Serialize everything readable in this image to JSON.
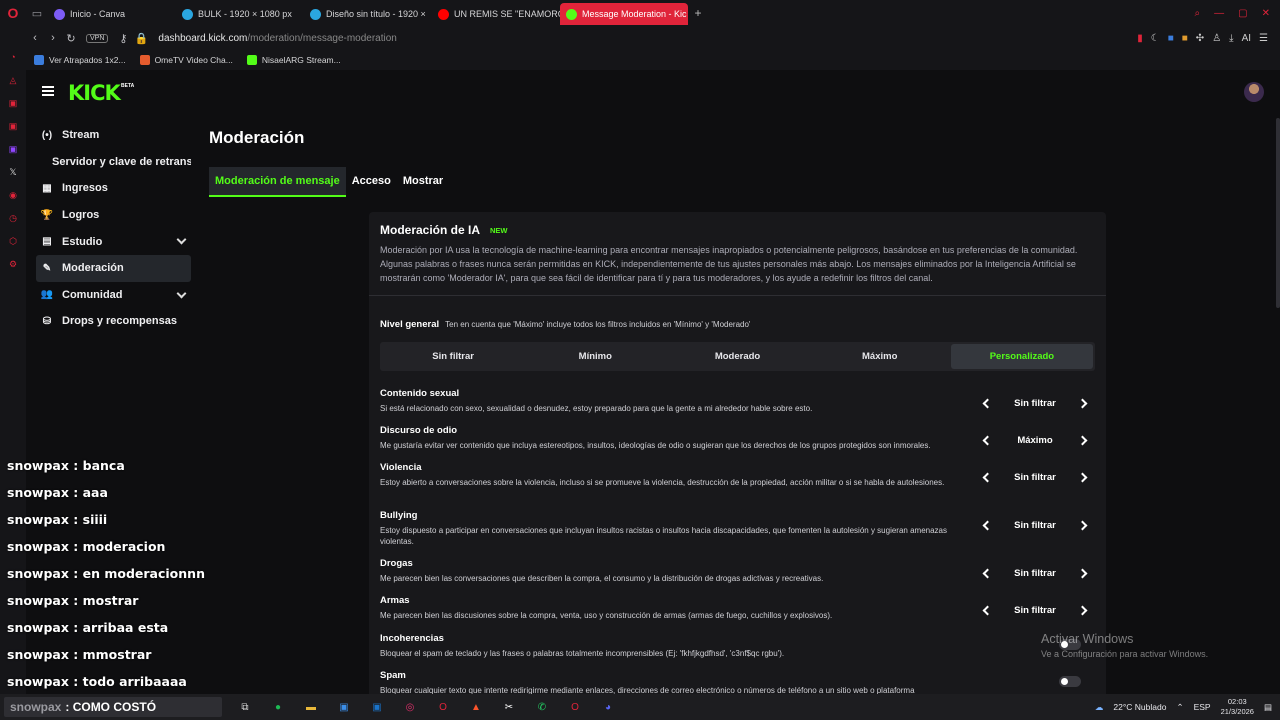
{
  "browser": {
    "tabs": [
      {
        "title": "Inicio - Canva",
        "fav_color": "#7d5cf5",
        "active": false
      },
      {
        "title": "BULK - 1920 × 1080 px",
        "fav_color": "#2aa6e0",
        "active": false
      },
      {
        "title": "Diseño sin título - 1920 ×",
        "fav_color": "#2aa6e0",
        "active": false
      },
      {
        "title": "UN REMIS SE \"ENAMORÓ\"",
        "fav_color": "#ff0000",
        "active": false
      },
      {
        "title": "Message Moderation - Kic",
        "fav_color": "#53fc18",
        "active": true
      }
    ],
    "url_host": "dashboard.kick.com",
    "url_path": "/moderation/message-moderation",
    "vpn_label": "VPN",
    "ai_label": "AI",
    "bookmarks": [
      {
        "label": "Ver Atrapados 1x2...",
        "color": "#3b7ddd"
      },
      {
        "label": "OmeTV Video Cha...",
        "color": "#e65c2e"
      },
      {
        "label": "NisaelARG Stream...",
        "color": "#53fc18"
      }
    ]
  },
  "kick": {
    "logo": "KICK",
    "beta": "BETA",
    "accent": "#53fc18"
  },
  "sidebar": {
    "items": [
      {
        "label": "Stream",
        "icon": "broadcast-icon",
        "glyph": "(•)"
      },
      {
        "label": "Servidor y clave de retransmisión",
        "icon": "",
        "glyph": ""
      },
      {
        "label": "Ingresos",
        "icon": "revenue-icon",
        "glyph": "▦"
      },
      {
        "label": "Logros",
        "icon": "trophy-icon",
        "glyph": "🏆"
      },
      {
        "label": "Estudio",
        "icon": "studio-icon",
        "glyph": "▤"
      },
      {
        "label": "Moderación",
        "icon": "wrench-icon",
        "glyph": "✎"
      },
      {
        "label": "Comunidad",
        "icon": "community-icon",
        "glyph": "👥"
      },
      {
        "label": "Drops y recompensas",
        "icon": "drops-icon",
        "glyph": "⛁"
      }
    ]
  },
  "chat": [
    {
      "user": "snowpax",
      "msg": "banca"
    },
    {
      "user": "snowpax",
      "msg": "aaa"
    },
    {
      "user": "snowpax",
      "msg": "siiii"
    },
    {
      "user": "snowpax",
      "msg": "moderacion"
    },
    {
      "user": "snowpax",
      "msg": "en moderacionnn"
    },
    {
      "user": "snowpax",
      "msg": "mostrar"
    },
    {
      "user": "snowpax",
      "msg": "arribaa esta"
    },
    {
      "user": "snowpax",
      "msg": "mmostrar"
    },
    {
      "user": "snowpax",
      "msg": "todo arribaaaa"
    }
  ],
  "main": {
    "title": "Moderación",
    "tabs": [
      "Moderación de mensaje",
      "Acceso",
      "Mostrar"
    ],
    "card": {
      "title": "Moderación de IA",
      "badge": "NEW",
      "description": "Moderación por IA usa la tecnología de machine-learning para encontrar mensajes inapropiados o potencialmente peligrosos, basándose en tus preferencias de la comunidad. Algunas palabras o frases nunca serán permitidas en KICK, independientemente de tus ajustes personales más abajo. Los mensajes eliminados por la Inteligencia Artificial se mostrarán como 'Moderador IA', para que sea fácil de identificar para tí y para tus moderadores, y los ayude a redefinir los filtros del canal.",
      "level_label": "Nivel general",
      "level_hint": "Ten en cuenta que 'Máximo' incluye todos los filtros incluidos en 'Mínimo' y 'Moderado'",
      "levels": [
        "Sin filtrar",
        "Mínimo",
        "Moderado",
        "Máximo",
        "Personalizado"
      ],
      "selected_level": "Personalizado",
      "categories": [
        {
          "name": "Contenido sexual",
          "desc": "Si está relacionado con sexo, sexualidad o desnudez, estoy preparado para que la gente a mi alrededor hable sobre esto.",
          "value": "Sin filtrar"
        },
        {
          "name": "Discurso de odio",
          "desc": "Me gustaría evitar ver contenido que incluya estereotipos, insultos, ideologías de odio o sugieran que los derechos de los grupos protegidos son inmorales.",
          "value": "Máximo"
        },
        {
          "name": "Violencia",
          "desc": "Estoy abierto a conversaciones sobre la violencia, incluso si se promueve la violencia, destrucción de la propiedad, acción militar o si se habla de autolesiones.",
          "value": "Sin filtrar"
        },
        {
          "name": "Bullying",
          "desc": "Estoy dispuesto a participar en conversaciones que incluyan insultos racistas o insultos hacia discapacidades, que fomenten la autolesión y sugieran amenazas violentas.",
          "value": "Sin filtrar"
        },
        {
          "name": "Drogas",
          "desc": "Me parecen bien las conversaciones que describen la compra, el consumo y la distribución de drogas adictivas y recreativas.",
          "value": "Sin filtrar"
        },
        {
          "name": "Armas",
          "desc": "Me parecen bien las discusiones sobre la compra, venta, uso y construcción de armas (armas de fuego, cuchillos y explosivos).",
          "value": "Sin filtrar"
        },
        {
          "name": "Incoherencias",
          "desc": "Bloquear el spam de teclado y las frases o palabras totalmente incomprensibles (Ej: 'fkhfjkgdfhsd', 'c3nf$qc rgbu').",
          "value": null
        },
        {
          "name": "Spam",
          "desc": "Bloquear cualquier texto que intente redirigirme mediante enlaces, direcciones de correo electrónico o números de teléfono a un sitio web o plataforma",
          "value": null
        }
      ]
    }
  },
  "watermark": {
    "line1": "Activar Windows",
    "line2": "Ve a Configuración para activar Windows."
  },
  "taskbar": {
    "search_user": "snowpax",
    "search_text": ": COMO COSTÓ",
    "weather": "22°C  Nublado",
    "lang": "ESP",
    "time": "02:03",
    "date": "21/3/2026"
  }
}
